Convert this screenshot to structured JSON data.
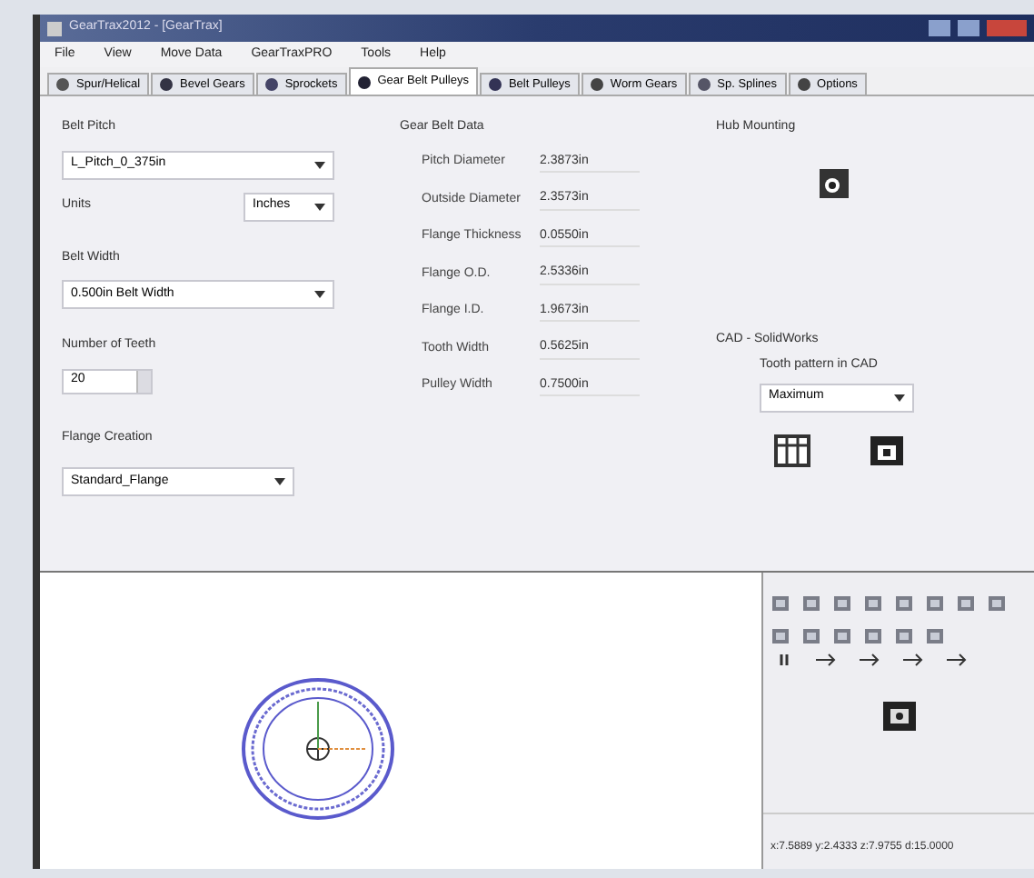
{
  "window": {
    "title": "GearTrax2012 - [GearTrax]"
  },
  "menu": [
    "File",
    "View",
    "Move Data",
    "GearTraxPRO",
    "Tools",
    "Help"
  ],
  "tabs": [
    {
      "label": "Spur/Helical",
      "selected": false
    },
    {
      "label": "Bevel Gears",
      "selected": false
    },
    {
      "label": "Sprockets",
      "selected": false
    },
    {
      "label": "Gear Belt Pulleys",
      "selected": true
    },
    {
      "label": "Belt Pulleys",
      "selected": false
    },
    {
      "label": "Worm Gears",
      "selected": false
    },
    {
      "label": "Sp. Splines",
      "selected": false
    },
    {
      "label": "Options",
      "selected": false
    }
  ],
  "left": {
    "belt_pitch_label": "Belt Pitch",
    "belt_pitch": "L_Pitch_0_375in",
    "units_label": "Units",
    "units": "Inches",
    "belt_width_label": "Belt Width",
    "belt_width": "0.500in Belt Width",
    "teeth_label": "Number of Teeth",
    "teeth": "20",
    "flange_label": "Flange Creation",
    "flange": "Standard_Flange"
  },
  "data": {
    "title": "Gear Belt Data",
    "rows": [
      {
        "label": "Pitch Diameter",
        "value": "2.3873in"
      },
      {
        "label": "Outside Diameter",
        "value": "2.3573in"
      },
      {
        "label": "Flange Thickness",
        "value": "0.0550in"
      },
      {
        "label": "Flange O.D.",
        "value": "2.5336in"
      },
      {
        "label": "Flange I.D.",
        "value": "1.9673in"
      },
      {
        "label": "Tooth Width",
        "value": "0.5625in"
      },
      {
        "label": "Pulley Width",
        "value": "0.7500in"
      }
    ]
  },
  "right": {
    "hub_label": "Hub Mounting",
    "cad_label": "CAD - SolidWorks",
    "pattern_label": "Tooth pattern in CAD",
    "pattern": "Maximum"
  },
  "status": "x:7.5889 y:2.4333 z:7.9755 d:15.0000"
}
